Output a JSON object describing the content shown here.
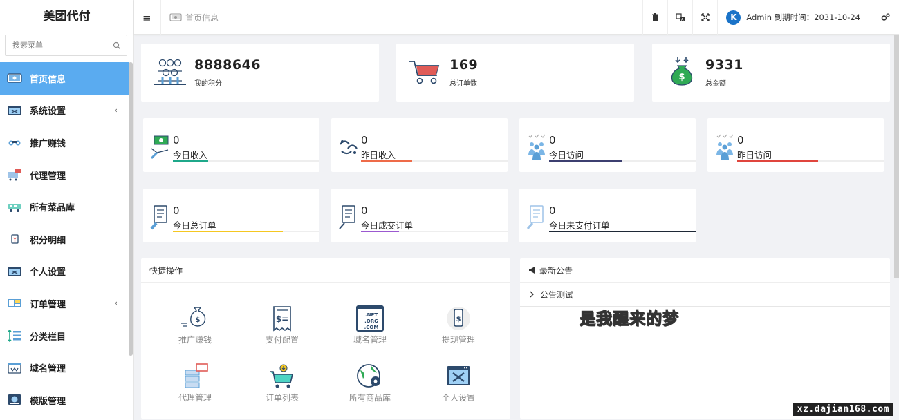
{
  "brand": {
    "title": "美团代付"
  },
  "search": {
    "placeholder": "搜索菜单"
  },
  "sidebar": {
    "items": [
      {
        "label": "首页信息",
        "icon": "home-icon",
        "active": true
      },
      {
        "label": "系统设置",
        "icon": "settings-window-icon",
        "has_arrow": true
      },
      {
        "label": "推广赚钱",
        "icon": "binoculars-icon"
      },
      {
        "label": "代理管理",
        "icon": "agent-icon"
      },
      {
        "label": "所有菜品库",
        "icon": "delivery-truck-icon"
      },
      {
        "label": "积分明细",
        "icon": "points-icon"
      },
      {
        "label": "个人设置",
        "icon": "profile-window-icon"
      },
      {
        "label": "订单管理",
        "icon": "order-icon",
        "has_arrow": true
      },
      {
        "label": "分类栏目",
        "icon": "category-icon"
      },
      {
        "label": "域名管理",
        "icon": "domain-icon"
      },
      {
        "label": "模版管理",
        "icon": "template-icon"
      }
    ],
    "arrow": "‹",
    "accent": "#5aabf0"
  },
  "header": {
    "menu_toggle": "≡",
    "home_tab": "首页信息",
    "user_name": "Admin",
    "expire_label": "到期时间：",
    "expire_date": "2031-10-24",
    "avatar_letter": "K",
    "icons": [
      "trash-icon",
      "translate-icon",
      "fullscreen-icon",
      "settings-icon"
    ]
  },
  "summary": [
    {
      "value": "8888646",
      "label": "我的积分",
      "icon": "points-people-icon"
    },
    {
      "value": "169",
      "label": "总订单数",
      "icon": "shopping-cart-icon"
    },
    {
      "value": "9331",
      "label": "总金额",
      "icon": "money-bag-icon"
    }
  ],
  "stats": [
    {
      "value": "0",
      "label": "今日收入",
      "color": "#1fa88a",
      "fill": 0.24
    },
    {
      "value": "0",
      "label": "昨日收入",
      "color": "#ee6b49",
      "fill": 0.35
    },
    {
      "value": "0",
      "label": "今日访问",
      "color": "#3c3f70",
      "fill": 0.5
    },
    {
      "value": "0",
      "label": "昨日访问",
      "color": "#e0453d",
      "fill": 0.55
    },
    {
      "value": "0",
      "label": "今日总订单",
      "color": "#f5c721",
      "fill": 0.75
    },
    {
      "value": "0",
      "label": "今日成交订单",
      "color": "#9b59d0",
      "fill": 0.26
    },
    {
      "value": "0",
      "label": "今日未支付订单",
      "color": "#1e2836",
      "fill": 1.0
    }
  ],
  "quick": {
    "title": "快捷操作",
    "items": [
      {
        "label": "推广赚钱",
        "icon": "money-hand-icon"
      },
      {
        "label": "支付配置",
        "icon": "receipt-icon"
      },
      {
        "label": "域名管理",
        "icon": "domain-net-org-com-icon"
      },
      {
        "label": "提现管理",
        "icon": "phone-dollar-icon"
      },
      {
        "label": "代理管理",
        "icon": "server-agent-icon"
      },
      {
        "label": "订单列表",
        "icon": "cart-download-icon"
      },
      {
        "label": "所有商品库",
        "icon": "globe-gear-icon"
      },
      {
        "label": "个人设置",
        "icon": "tools-window-icon"
      }
    ]
  },
  "notice": {
    "title": "最新公告",
    "items": [
      "公告测试"
    ],
    "scroll_text": "是我醒来的梦"
  },
  "watermark": "xz.dajian168.com"
}
